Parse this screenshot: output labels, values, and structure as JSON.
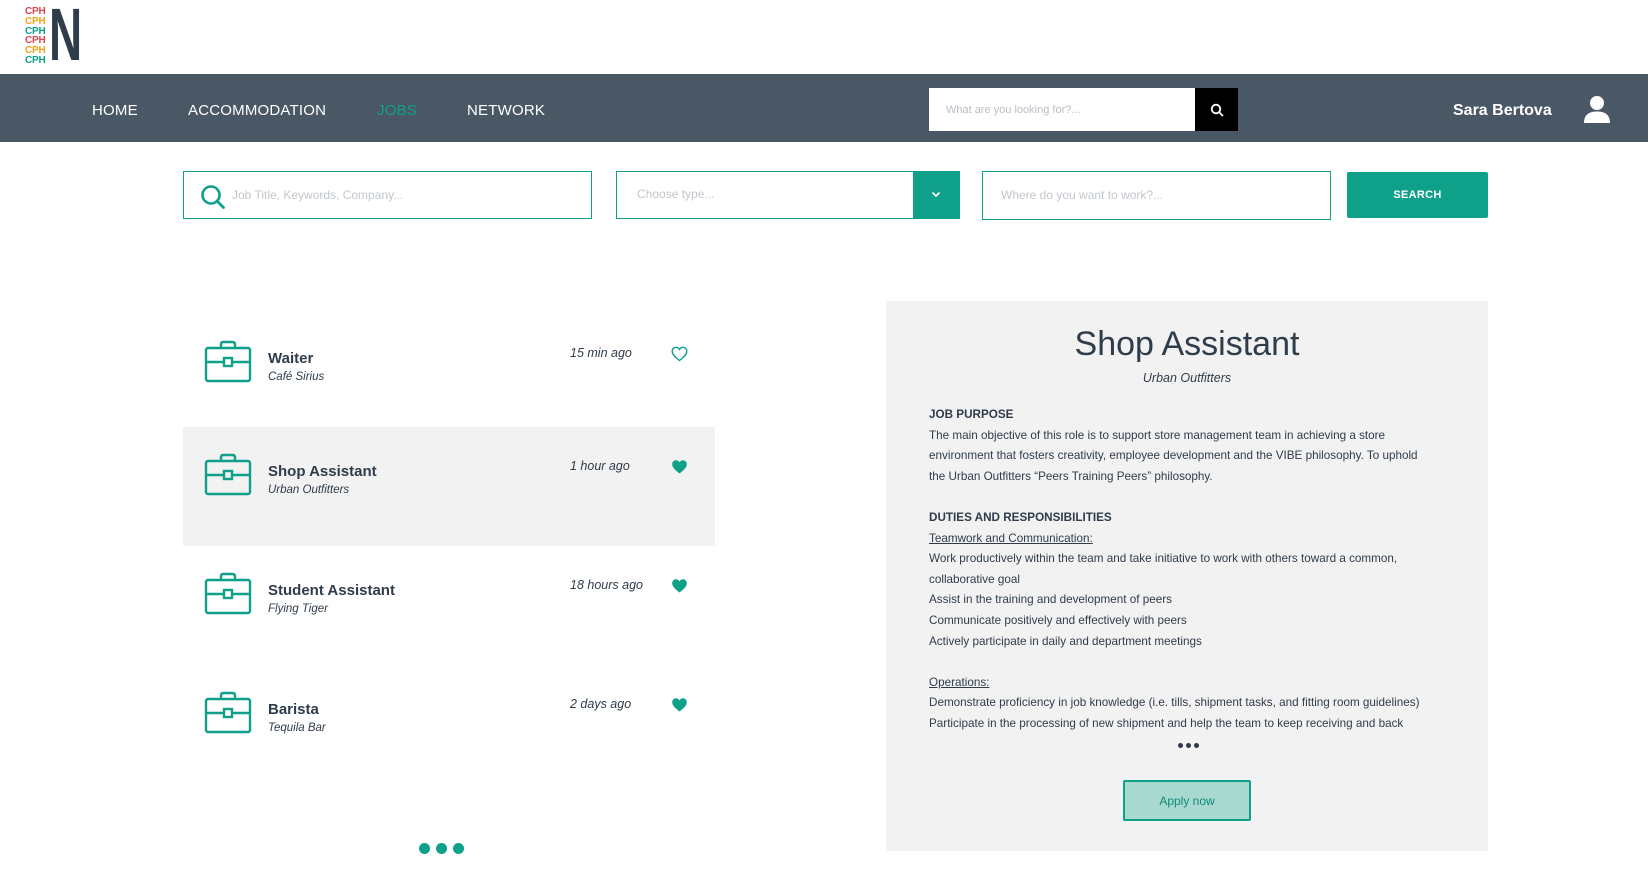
{
  "logo": {
    "stack": [
      {
        "text": "CPH",
        "color": "#e0454f"
      },
      {
        "text": "CPH",
        "color": "#f3a21b"
      },
      {
        "text": "CPH",
        "color": "#0fa08a"
      },
      {
        "text": "CPH",
        "color": "#e0454f"
      },
      {
        "text": "CPH",
        "color": "#f3a21b"
      },
      {
        "text": "CPH",
        "color": "#0fa08a"
      }
    ],
    "letter": "N"
  },
  "nav": {
    "items": [
      {
        "label": "HOME",
        "active": false
      },
      {
        "label": "ACCOMMODATION",
        "active": false
      },
      {
        "label": "JOBS",
        "active": true
      },
      {
        "label": "NETWORK",
        "active": false
      }
    ],
    "search_placeholder": "What are you looking for?...",
    "user_name": "Sara Bertova"
  },
  "filters": {
    "keyword_placeholder": "Job Title, Keywords, Company...",
    "type_placeholder": "Choose type...",
    "location_placeholder": "Where do you want to work?...",
    "search_label": "SEARCH"
  },
  "jobs": [
    {
      "title": "Waiter",
      "company": "Café Sirius",
      "time": "15 min ago",
      "favorite": false,
      "selected": false
    },
    {
      "title": "Shop Assistant",
      "company": "Urban Outfitters",
      "time": "1 hour ago",
      "favorite": true,
      "selected": true
    },
    {
      "title": "Student Assistant",
      "company": "Flying Tiger",
      "time": "18 hours ago",
      "favorite": true,
      "selected": false
    },
    {
      "title": "Barista",
      "company": "Tequila Bar",
      "time": "2 days ago",
      "favorite": true,
      "selected": false
    }
  ],
  "detail": {
    "title": "Shop Assistant",
    "company": "Urban Outfitters",
    "purpose_heading": "JOB PURPOSE",
    "purpose_lines": [
      "The main objective of this role is to support store management team in achieving a store",
      "environment that fosters creativity, employee development and the VIBE philosophy. To uphold",
      "the Urban Outfitters “Peers Training Peers” philosophy."
    ],
    "duties_heading": "DUTIES AND RESPONSIBILITIES",
    "teamwork_heading": "Teamwork and Communication:",
    "teamwork_lines": [
      "Work productively within the team and take initiative to work with others toward a common,",
      "collaborative goal",
      "Assist in the training and development of peers",
      "Communicate positively and effectively with peers",
      "Actively participate in daily and department meetings"
    ],
    "operations_heading": "Operations:",
    "operations_lines": [
      "Demonstrate proficiency in job knowledge (i.e. tills, shipment tasks, and fitting room guidelines)",
      "Participate in the processing of new shipment and help the team to keep receiving and back"
    ],
    "apply_label": "Apply now"
  },
  "colors": {
    "accent": "#0fa08a",
    "nav_bg": "#4a5866",
    "text_dark": "#2f3c4b",
    "panel_bg": "#f2f2f2"
  }
}
